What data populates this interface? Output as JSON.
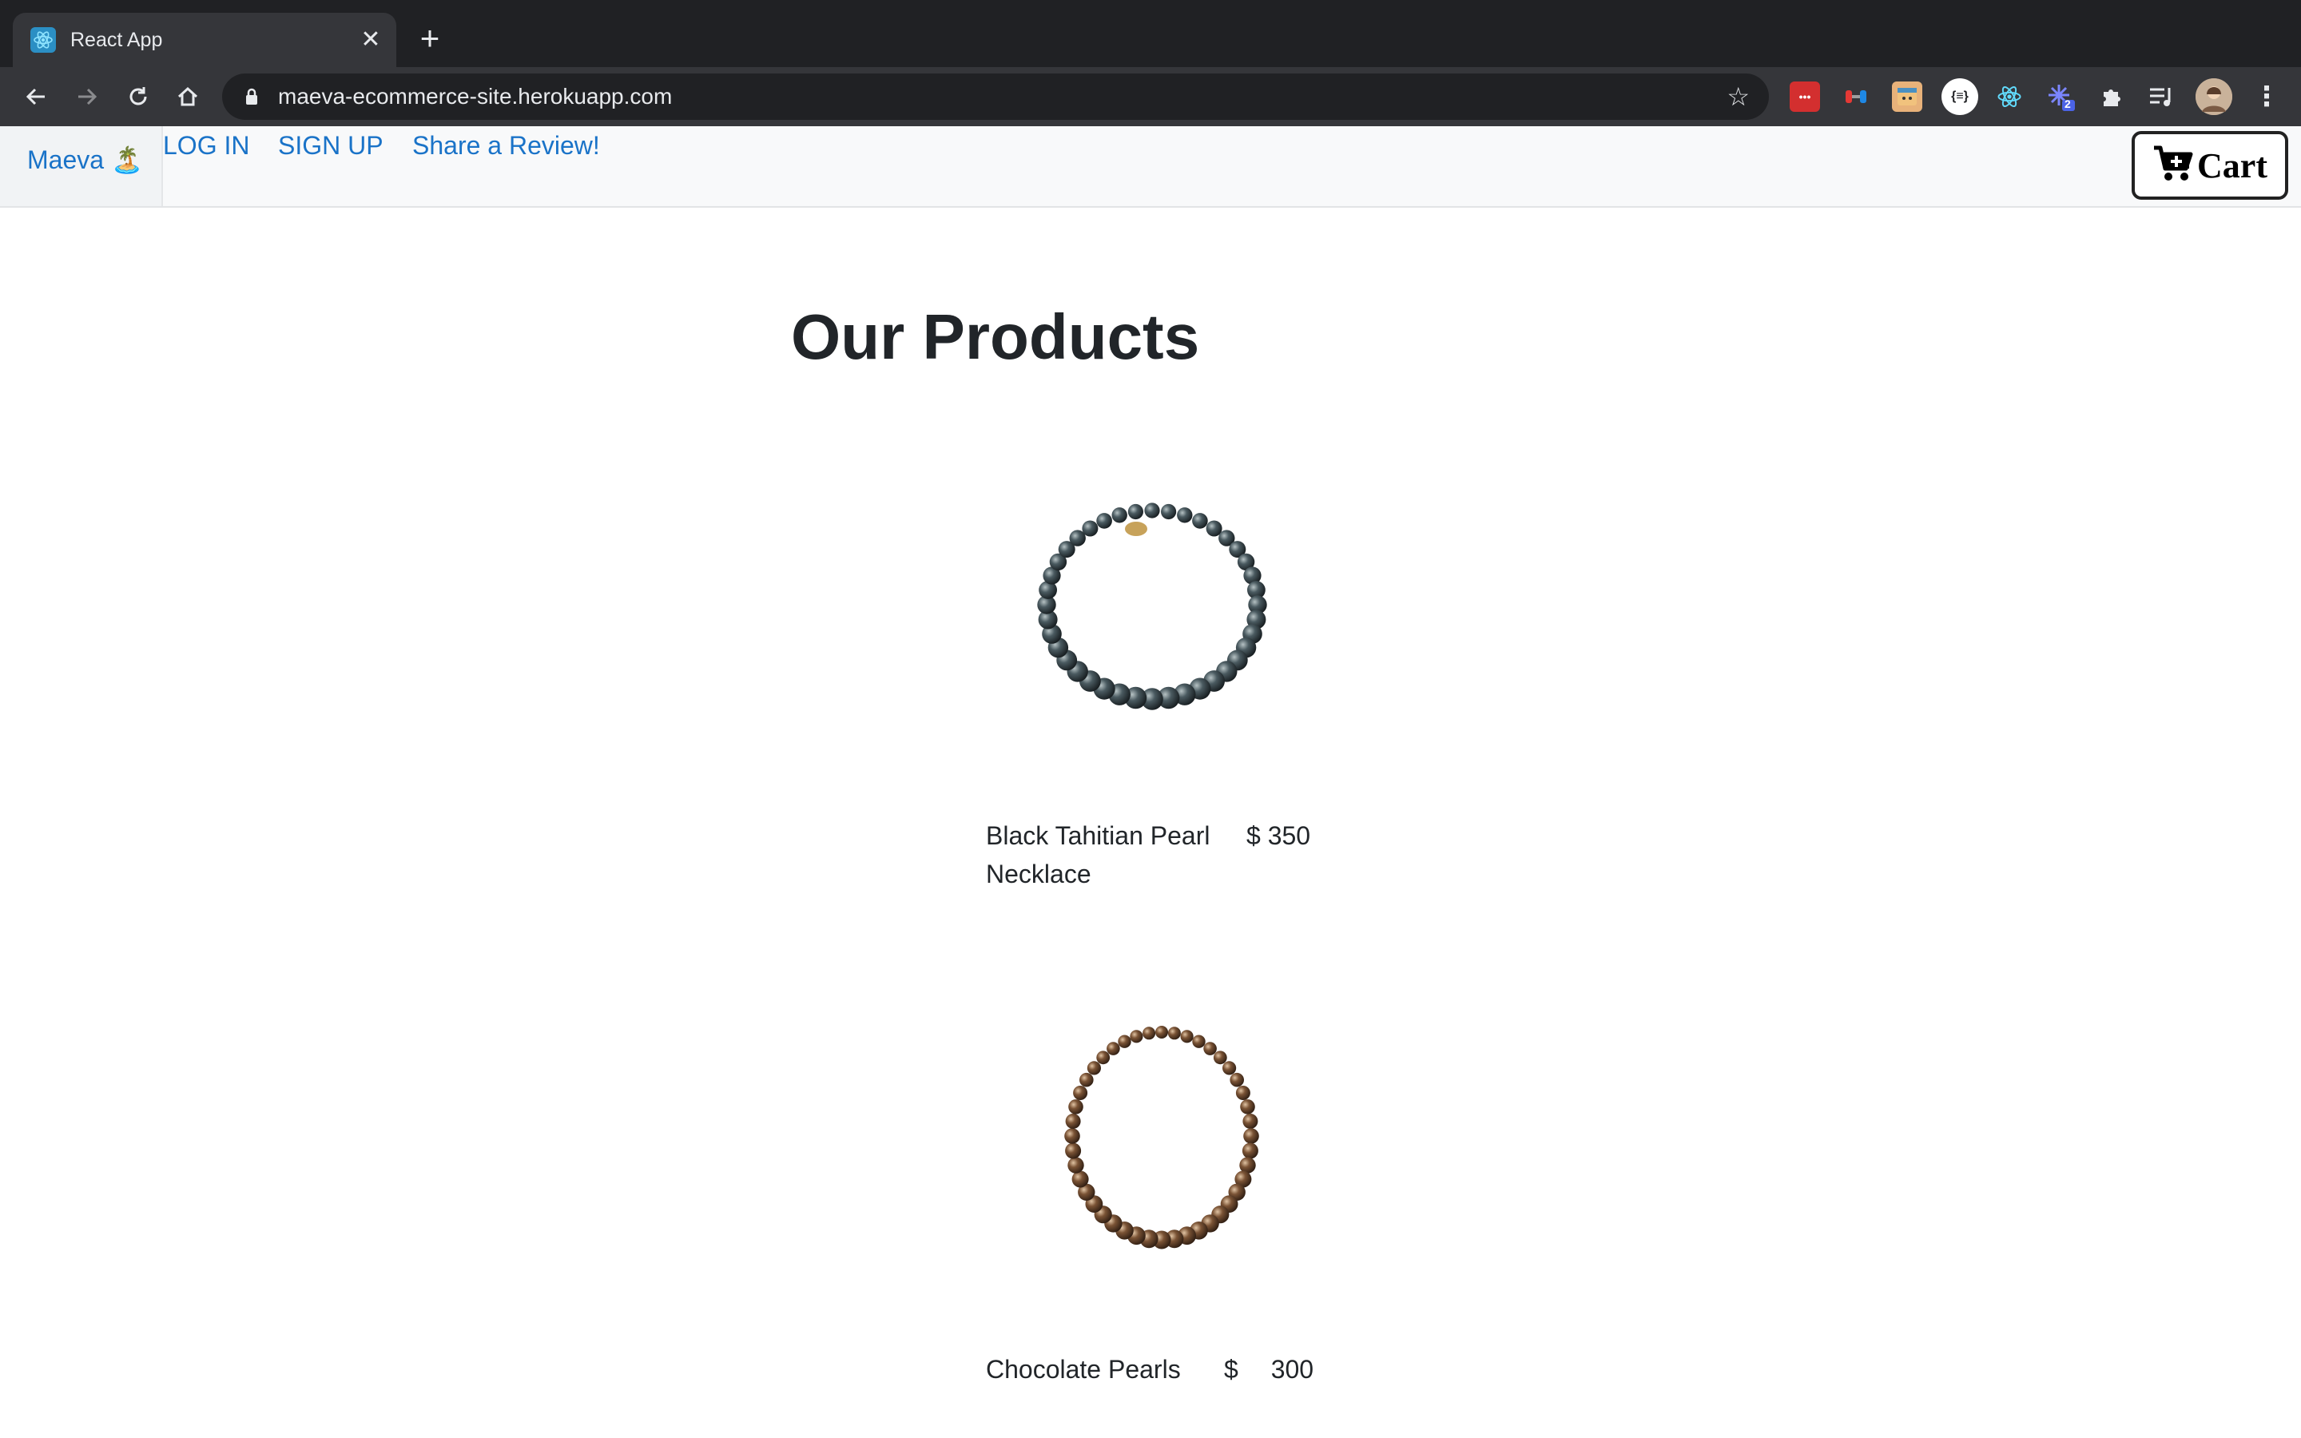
{
  "browser": {
    "tab_title": "React App",
    "url": "maeva-ecommerce-site.herokuapp.com",
    "extensions": [
      "lastpass-icon",
      "colorpick-icon",
      "fox-icon",
      "json-viewer-icon",
      "react-devtools-icon",
      "loading-extension-icon",
      "puzzle-icon",
      "playlist-icon"
    ],
    "extension_badge": "2"
  },
  "navbar": {
    "brand": "Maeva 🏝️",
    "links": [
      "LOG IN",
      "SIGN UP",
      "Share a Review!"
    ],
    "cart_label": "Cart"
  },
  "main": {
    "title_part1": "Our",
    "title_part2": "Products",
    "products": [
      {
        "name": "Black Tahitian Pearl Necklace",
        "currency": "$",
        "price": "350",
        "pearl_color": "#3e4a52"
      },
      {
        "name": "Chocolate Pearls",
        "currency": "$",
        "price": "300",
        "pearl_color": "#6b4a33"
      }
    ]
  }
}
